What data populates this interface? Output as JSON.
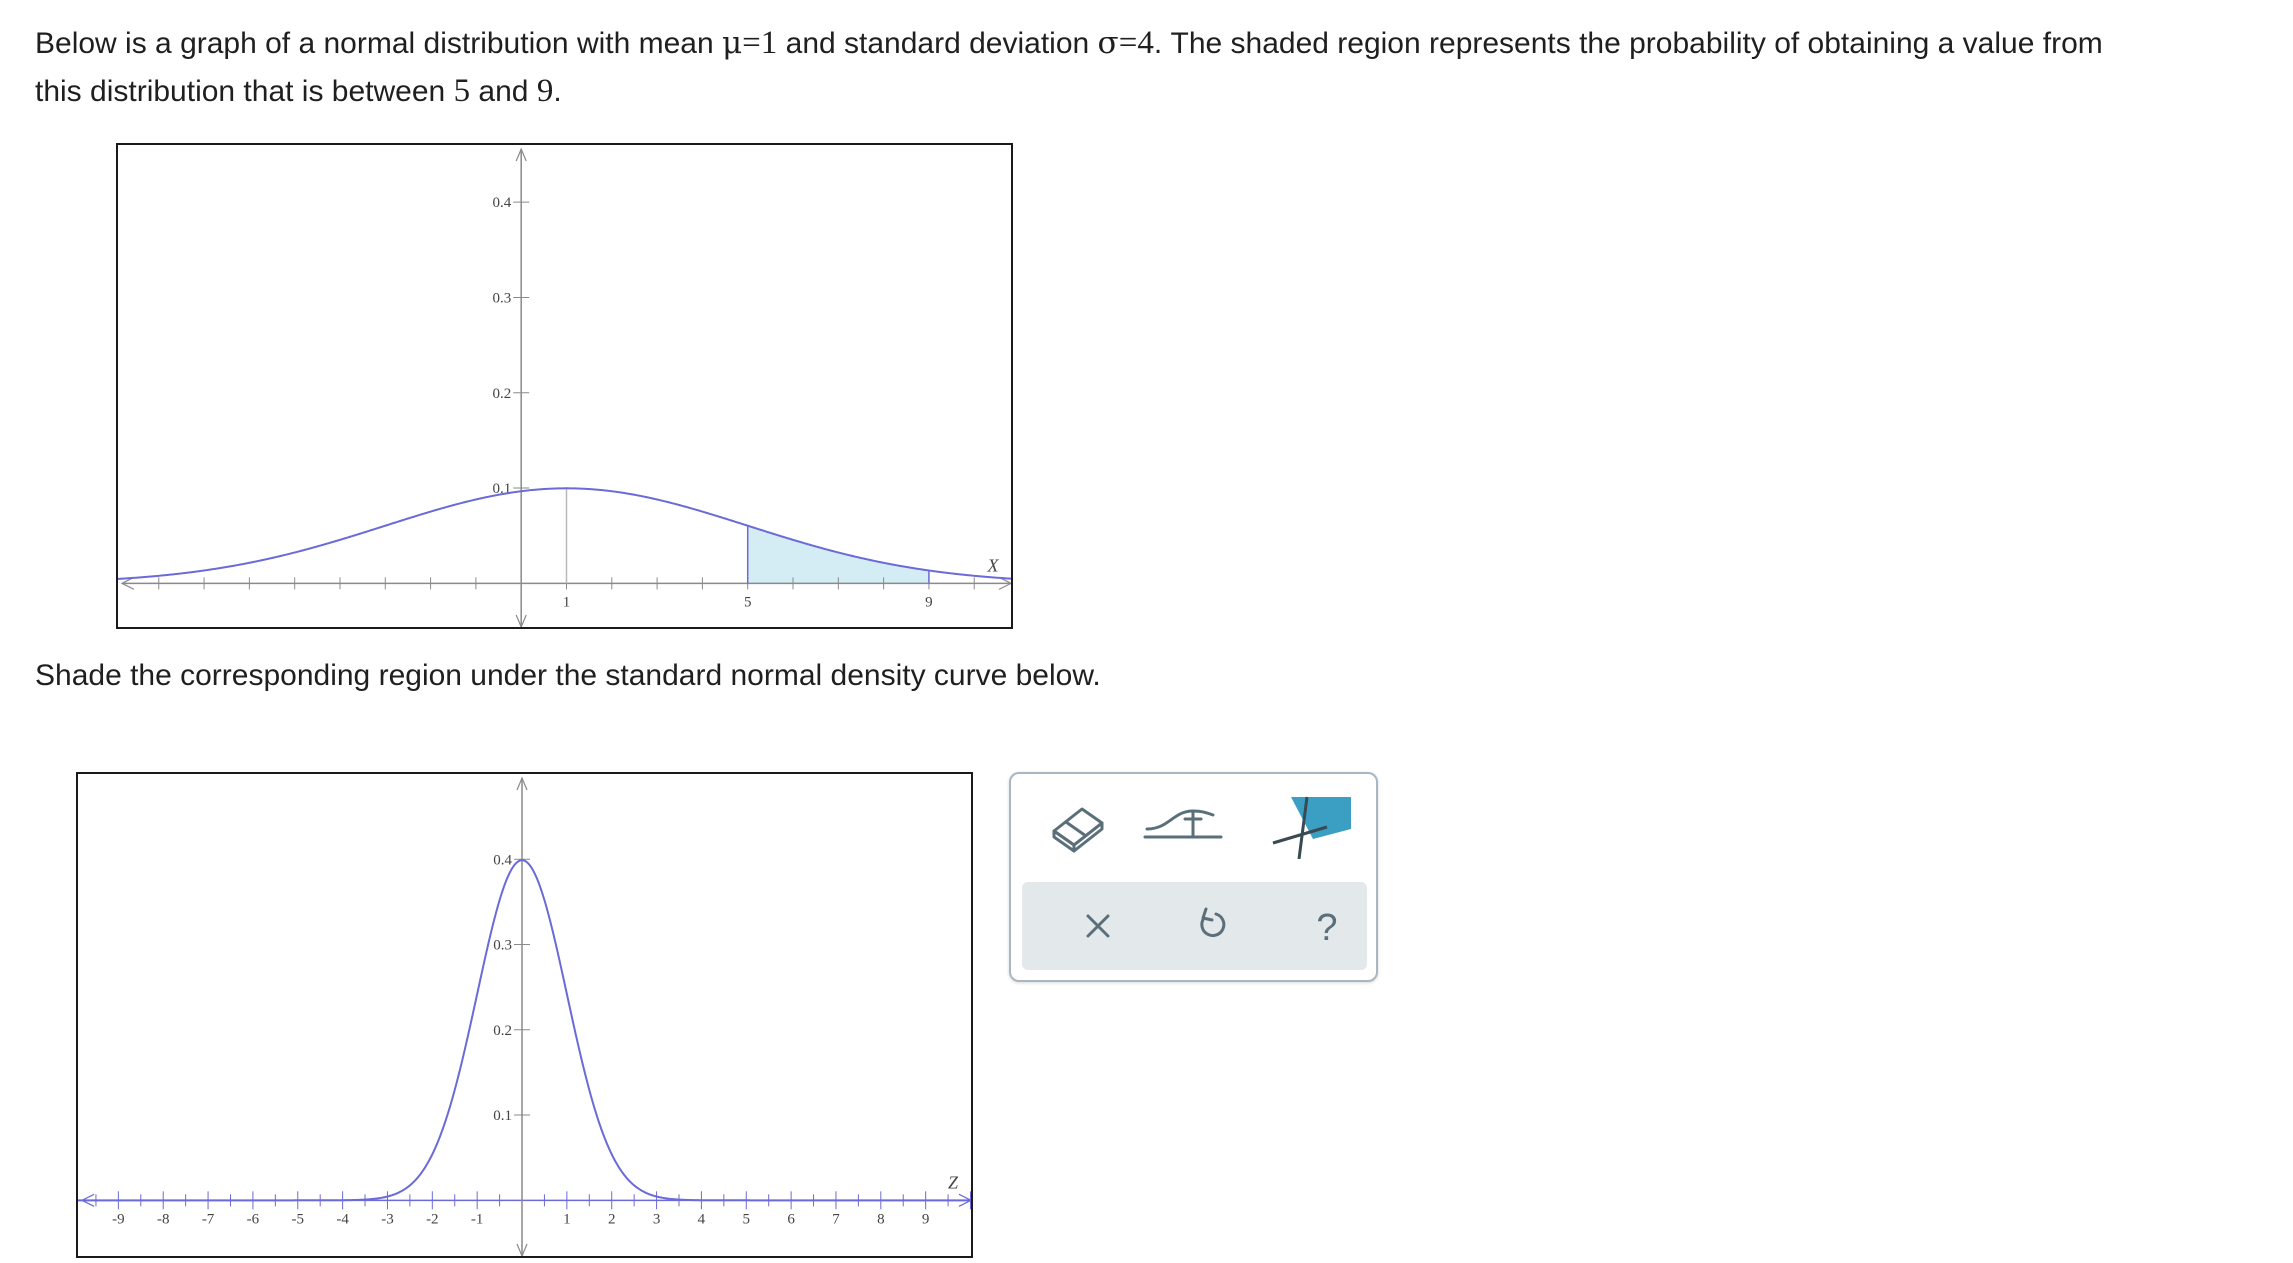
{
  "intro": {
    "part1": "Below is a graph of a normal distribution with mean ",
    "mu_symbol": "μ",
    "eq1": "=",
    "mean": "1",
    "part2": " and standard deviation ",
    "sigma_symbol": "σ",
    "eq2": "=",
    "sd": "4",
    "part3": ". The shaded region represents the probability of obtaining a value from",
    "line2_part1": "this distribution that is between ",
    "lower": "5",
    "and": " and ",
    "upper": "9",
    "period": "."
  },
  "instruction": "Shade the corresponding region under the standard normal density curve below.",
  "top_graph": {
    "chart_data": {
      "type": "area",
      "distribution": "normal",
      "mean": 1,
      "sd": 4,
      "shaded_from": 5,
      "shaded_to": 9,
      "xlim": [
        -8.9,
        10.9
      ],
      "ylim": [
        -0.05,
        0.46
      ],
      "x_tick_labels": [
        "1",
        "5",
        "9"
      ],
      "y_tick_labels": [
        "0.1",
        "0.2",
        "0.3",
        "0.4"
      ],
      "x_axis_letter": "X",
      "curve_color": "#6a6ad8",
      "shade_color": "#d4edf4"
    }
  },
  "bottom_graph": {
    "chart_data": {
      "type": "line",
      "distribution": "normal",
      "mean": 0,
      "sd": 1,
      "xlim": [
        -9.9,
        10.1
      ],
      "ylim": [
        -0.07,
        0.5
      ],
      "x_tick_labels": [
        "-9",
        "-8",
        "-7",
        "-6",
        "-5",
        "-4",
        "-3",
        "-2",
        "-1",
        "1",
        "2",
        "3",
        "4",
        "5",
        "6",
        "7",
        "8",
        "9"
      ],
      "y_tick_labels": [
        "0.1",
        "0.2",
        "0.3",
        "0.4"
      ],
      "x_axis_letter": "Z",
      "curve_color": "#6a6ad8"
    }
  },
  "tools": {
    "items": [
      "eraser-tool",
      "point-tool",
      "shade-region-tool"
    ],
    "actions": [
      "clear-action",
      "undo-action",
      "help-action"
    ],
    "help_glyph": "?",
    "accent_color": "#3a9fc3",
    "icon_color": "#5a6f7a"
  }
}
